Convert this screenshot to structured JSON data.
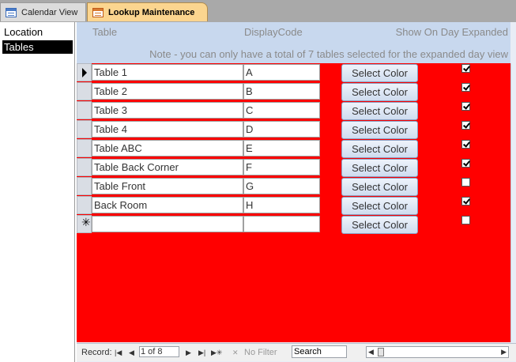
{
  "tabs": [
    {
      "label": "Calendar View",
      "icon": "form-icon"
    },
    {
      "label": "Lookup Maintenance",
      "icon": "form-icon"
    }
  ],
  "sidebar": {
    "items": [
      {
        "label": "Location",
        "selected": false
      },
      {
        "label": "Tables",
        "selected": true
      }
    ]
  },
  "header": {
    "col_table": "Table",
    "col_code": "DisplayCode",
    "col_show": "Show On Day Expanded",
    "note": "Note - you can only have a total of 7 tables selected for the expanded day view"
  },
  "rows": [
    {
      "name": "Table 1",
      "code": "A",
      "button": "Select Color",
      "show": true
    },
    {
      "name": "Table 2",
      "code": "B",
      "button": "Select Color",
      "show": true
    },
    {
      "name": "Table 3",
      "code": "C",
      "button": "Select Color",
      "show": true
    },
    {
      "name": "Table 4",
      "code": "D",
      "button": "Select Color",
      "show": true
    },
    {
      "name": "Table ABC",
      "code": "E",
      "button": "Select Color",
      "show": true
    },
    {
      "name": "Table Back Corner",
      "code": "F",
      "button": "Select Color",
      "show": true
    },
    {
      "name": "Table Front",
      "code": "G",
      "button": "Select Color",
      "show": false
    },
    {
      "name": "Back Room",
      "code": "H",
      "button": "Select Color",
      "show": true
    }
  ],
  "new_row": {
    "name": "",
    "code": "",
    "button": "Select Color",
    "show": false
  },
  "record_nav": {
    "label": "Record:",
    "current": "1 of 8",
    "no_filter": "No Filter",
    "search": "Search"
  },
  "colors": {
    "detail_bg": "#ff0000",
    "header_bg": "#c8d8ee",
    "active_tab": "#fbd58f"
  }
}
